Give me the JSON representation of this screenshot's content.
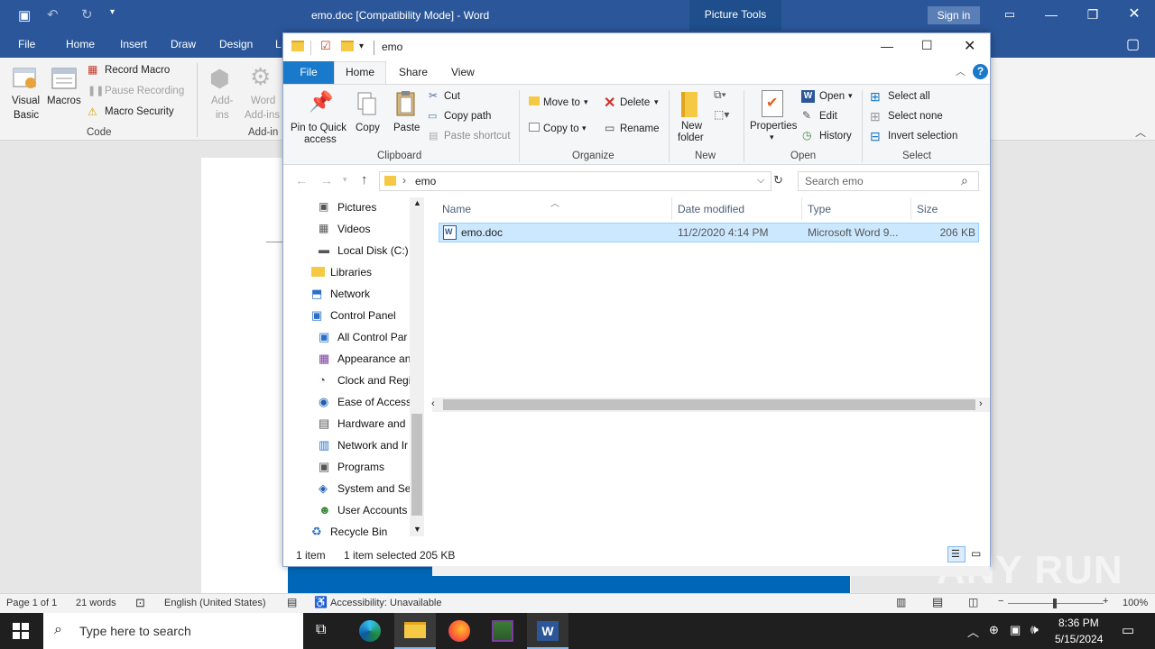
{
  "word": {
    "title": "emo.doc [Compatibility Mode]  -  Word",
    "picture_tools": "Picture Tools",
    "sign_in": "Sign in",
    "tabs": [
      "File",
      "Home",
      "Insert",
      "Draw",
      "Design",
      "L"
    ],
    "ribbon": {
      "visual_basic": "Visual Basic",
      "visual_basic_1": "Visual",
      "visual_basic_2": "Basic",
      "macros": "Macros",
      "record_macro": "Record Macro",
      "pause_recording": "Pause Recording",
      "macro_security": "Macro Security",
      "group_code": "Code",
      "addins_1": "Add-",
      "addins_2": "ins",
      "word_addins_1": "Word",
      "word_addins_2": "Add-ins",
      "group_addins": "Add-in"
    },
    "status": {
      "page": "Page 1 of 1",
      "words": "21 words",
      "language": "English (United States)",
      "accessibility": "Accessibility: Unavailable",
      "zoom": "100%"
    }
  },
  "explorer": {
    "title": "emo",
    "tabs": {
      "file": "File",
      "home": "Home",
      "share": "Share",
      "view": "View"
    },
    "ribbon": {
      "pin_1": "Pin to Quick",
      "pin_2": "access",
      "copy": "Copy",
      "paste": "Paste",
      "cut": "Cut",
      "copy_path": "Copy path",
      "paste_shortcut": "Paste shortcut",
      "group_clipboard": "Clipboard",
      "move_to": "Move to",
      "copy_to": "Copy to",
      "delete": "Delete",
      "rename": "Rename",
      "group_organize": "Organize",
      "new_folder_1": "New",
      "new_folder_2": "folder",
      "group_new": "New",
      "properties": "Properties",
      "open": "Open",
      "edit": "Edit",
      "history": "History",
      "group_open": "Open",
      "select_all": "Select all",
      "select_none": "Select none",
      "invert_selection": "Invert selection",
      "group_select": "Select"
    },
    "address": {
      "crumb": "emo",
      "search_placeholder": "Search emo"
    },
    "nav": [
      "Pictures",
      "Videos",
      "Local Disk (C:)",
      "Libraries",
      "Network",
      "Control Panel",
      "All Control Par",
      "Appearance an",
      "Clock and Regi",
      "Ease of Access",
      "Hardware and",
      "Network and Ir",
      "Programs",
      "System and Se",
      "User Accounts",
      "Recycle Bin"
    ],
    "columns": {
      "name": "Name",
      "date": "Date modified",
      "type": "Type",
      "size": "Size"
    },
    "files": [
      {
        "name": "emo.doc",
        "date": "11/2/2020 4:14 PM",
        "type": "Microsoft Word 9...",
        "size": "206 KB"
      }
    ],
    "status": {
      "count": "1 item",
      "selected": "1 item selected  205 KB"
    }
  },
  "taskbar": {
    "search_placeholder": "Type here to search",
    "time": "8:36 PM",
    "date": "5/15/2024"
  },
  "watermark": "ANY RUN"
}
